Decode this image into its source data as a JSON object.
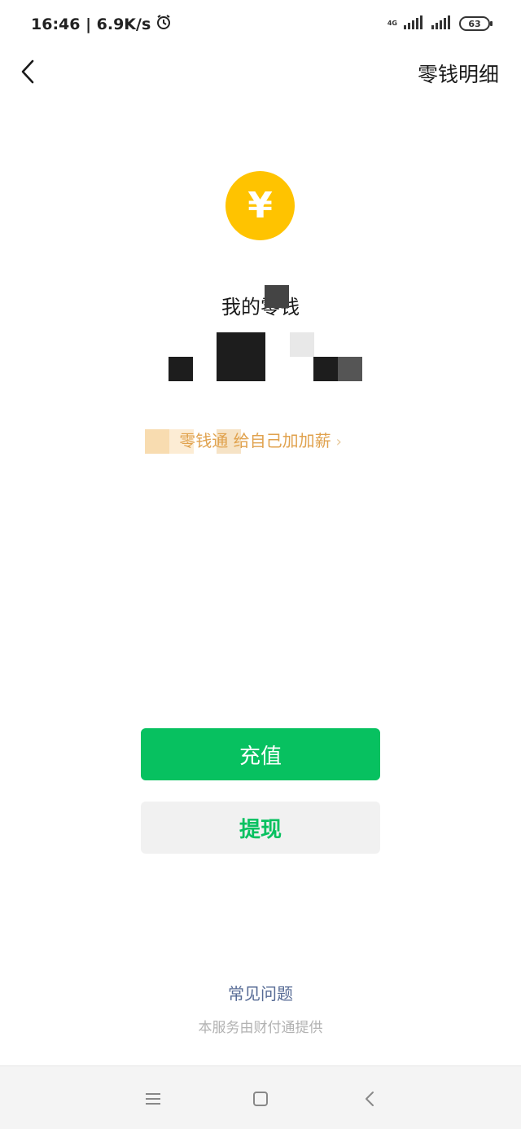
{
  "status_bar": {
    "time_speed": "16:46 | 6.9K/s",
    "network_label": "4G",
    "battery": "63"
  },
  "nav": {
    "details_link": "零钱明细"
  },
  "balance": {
    "title": "我的零钱",
    "amount": ""
  },
  "promo": {
    "text": "零钱通 给自己加加薪"
  },
  "actions": {
    "recharge_label": "充值",
    "withdraw_label": "提现"
  },
  "footer": {
    "faq_label": "常见问题",
    "provider_text": "本服务由财付通提供"
  },
  "icons": {
    "coin_symbol": "¥"
  },
  "colors": {
    "primary_green": "#07C160",
    "coin_yellow": "#FFC300",
    "link_blue": "#576B95",
    "promo_orange": "#E0A24E"
  }
}
